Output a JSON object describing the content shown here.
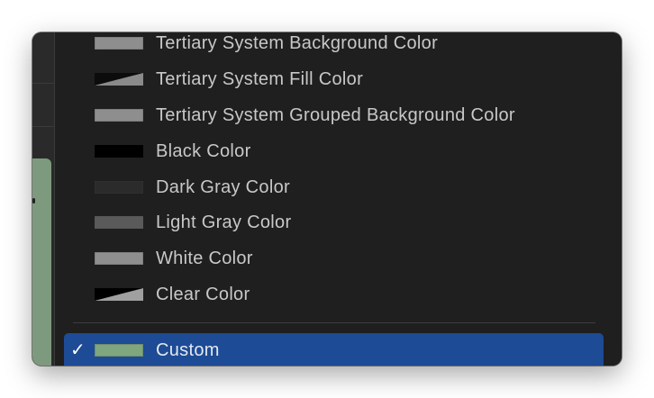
{
  "menu": {
    "items": [
      {
        "label": "Tertiary System Background Color",
        "swatch": "solid",
        "color": "#8e8e8e"
      },
      {
        "label": "Tertiary System Fill Color",
        "swatch": "triangle",
        "color": "#8a8a8a"
      },
      {
        "label": "Tertiary System Grouped Background Color",
        "swatch": "solid",
        "color": "#8e8e8e"
      },
      {
        "label": "Black Color",
        "swatch": "solid",
        "color": "#000000"
      },
      {
        "label": "Dark Gray Color",
        "swatch": "solid",
        "color": "#2b2b2b"
      },
      {
        "label": "Light Gray Color",
        "swatch": "solid",
        "color": "#5a5a5a"
      },
      {
        "label": "White Color",
        "swatch": "solid",
        "color": "#8f8f8f"
      },
      {
        "label": "Clear Color",
        "swatch": "triangle",
        "color": "#a0a0a0"
      }
    ],
    "selected": {
      "check": "✓",
      "label": "Custom",
      "color": "#7fa67f"
    }
  },
  "colors": {
    "menu_bg": "#1f1f1f",
    "highlight": "#1d4b95",
    "text": "#c8c8c8",
    "background_swatch": "#7e9a7e"
  }
}
